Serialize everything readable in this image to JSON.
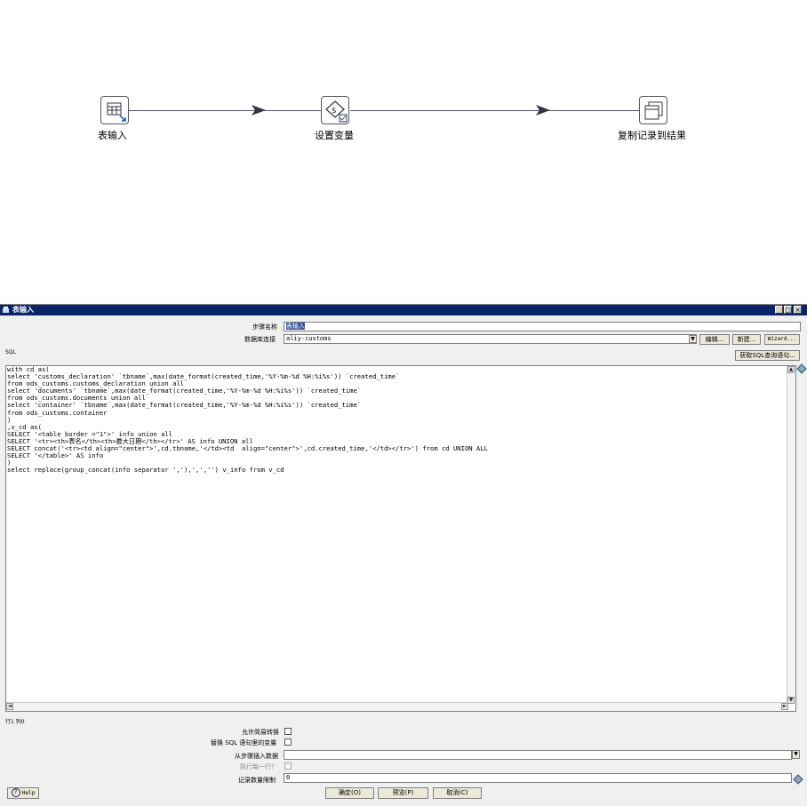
{
  "canvas": {
    "steps": [
      {
        "label": "表输入",
        "icon": "table-input-icon"
      },
      {
        "label": "设置变量",
        "icon": "set-variable-icon"
      },
      {
        "label": "复制记录到结果",
        "icon": "copy-rows-icon"
      }
    ]
  },
  "dialog": {
    "title": "表输入",
    "window_buttons": {
      "minimize": "_",
      "maximize": "□",
      "close": "×"
    },
    "step_name_label": "步骤名称",
    "step_name_value": "表输入",
    "connection_label": "数据库连接",
    "connection_value": "aliy-customs",
    "edit_button": "编辑...",
    "new_button": "新建...",
    "wizard_button": "Wizard...",
    "get_sql_button": "获取SQL查询语句...",
    "sql_label": "SQL",
    "sql_lines": [
      "with cd as(",
      "select 'customs_declaration' `tbname`,max(date_format(created_time,'%Y-%m-%d %H:%i%s')) `created_time`",
      "from ods_customs.customs_declaration union all",
      "select 'documents' `tbname`,max(date_format(created_time,'%Y-%m-%d %H:%i%s')) `created_time`",
      "from ods_customs.documents union all",
      "select 'container' `tbname`,max(date_format(created_time,'%Y-%m-%d %H:%i%s')) `created_time`",
      "from ods_customs.container",
      ")",
      ",v_cd as(",
      "SELECT '<table border =\"1\">' info union all",
      "SELECT '<tr><th>表名</th><th>最大日期</th></tr>' AS info UNION all",
      "SELECT concat('<tr><td align=\"center\">',cd.tbname,'</td><td  align=\"center\">',cd.created_time,'</td></tr>') from cd UNION ALL",
      "SELECT '</table>' AS info",
      ")",
      "select replace(group_concat(info separator ','),',','') v_info from v_cd"
    ],
    "position_text": "行1 列0",
    "lazy_conversion_label": "允许简易转换",
    "replace_variables_label": "替换 SQL 语句里的变量",
    "insert_data_label": "从步骤插入数据",
    "insert_data_value": "",
    "execute_each_row_label": "执行每一行?",
    "limit_label": "记录数量限制",
    "limit_value": "0",
    "help_button": "Help",
    "ok_button": "确定(O)",
    "preview_button": "预览(P)",
    "cancel_button": "取消(C)"
  }
}
